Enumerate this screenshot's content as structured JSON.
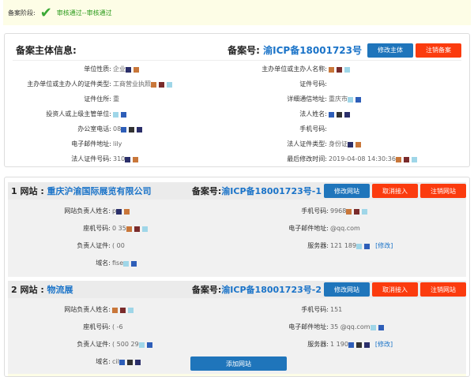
{
  "banner": {
    "label": "备案阶段:",
    "status": "审核通过--审核通过",
    "icon": "check-icon"
  },
  "subject": {
    "title": "备案主体信息:",
    "record_label": "备案号: ",
    "record_no": "渝ICP备18001723号",
    "edit_btn": "修改主体",
    "cancel_btn": "注销备案",
    "left": [
      {
        "label": "单位性质:",
        "value": "企业"
      },
      {
        "label": "主办单位或主办人的证件类型:",
        "value": "工商营业执照"
      },
      {
        "label": "证件住所:",
        "value": "重"
      },
      {
        "label": "投资人或上级主管单位:",
        "value": ""
      },
      {
        "label": "办公室电话:",
        "value": "08"
      },
      {
        "label": "电子邮件地址:",
        "value": "lily"
      },
      {
        "label": "法人证件号码:",
        "value": "310"
      }
    ],
    "right": [
      {
        "label": "主办单位或主办人名称:",
        "value": ""
      },
      {
        "label": "证件号码:",
        "value": ""
      },
      {
        "label": "详细通信地址:",
        "value": "重庆市"
      },
      {
        "label": "法人姓名:",
        "value": ""
      },
      {
        "label": "手机号码:",
        "value": ""
      },
      {
        "label": "法人证件类型:",
        "value": "身份证"
      },
      {
        "label": "最后修改时间:",
        "value": "2019-04-08 14:30:36"
      }
    ]
  },
  "sites": [
    {
      "index": "1 网站 : ",
      "name": "重庆沪渝国际展览有限公司",
      "record_label": "备案号:",
      "record_no": "渝ICP备18001723号-1",
      "edit": "修改网站",
      "unlink": "取消接入",
      "cancel": "注销网站",
      "left": [
        {
          "label": "网站负责人姓名:",
          "value": "p"
        },
        {
          "label": "座机号码:",
          "value": "0 35"
        },
        {
          "label": "负责人证件:",
          "value": "( 00"
        },
        {
          "label": "域名:",
          "value": "fise"
        }
      ],
      "right": [
        {
          "label": "手机号码:",
          "value": "9968"
        },
        {
          "label": "电子邮件地址:",
          "value": "@qq.com"
        },
        {
          "label": "服务器:",
          "value": "121 189",
          "link": "[修改]"
        }
      ]
    },
    {
      "index": "2 网站 : ",
      "name": "物流展",
      "record_label": "备案号:",
      "record_no": "渝ICP备18001723号-2",
      "edit": "修改网站",
      "unlink": "取消接入",
      "cancel": "注销网站",
      "left": [
        {
          "label": "网站负责人姓名:",
          "value": ""
        },
        {
          "label": "座机号码:",
          "value": "( -6"
        },
        {
          "label": "负责人证件:",
          "value": "( 500 29"
        },
        {
          "label": "域名:",
          "value": "cil"
        }
      ],
      "right": [
        {
          "label": "手机号码:",
          "value": "151"
        },
        {
          "label": "电子邮件地址:",
          "value": "35 @qq.com"
        },
        {
          "label": "服务器:",
          "value": "1 190",
          "link": "[修改]"
        }
      ]
    }
  ],
  "add_site": "添加网站",
  "colors": {
    "blue_button": "#1f75bb",
    "red_button": "#fb3b0e",
    "link": "#1a73c8",
    "banner_bg": "#fdfde6",
    "status": "#2a9a1a"
  }
}
